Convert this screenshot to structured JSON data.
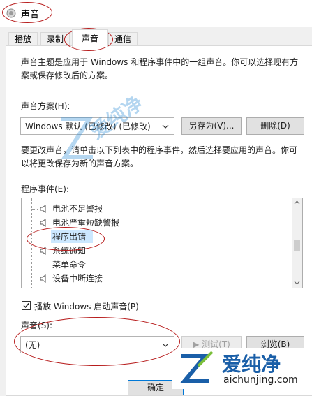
{
  "window": {
    "title": "声音"
  },
  "tabs": [
    {
      "label": "播放"
    },
    {
      "label": "录制"
    },
    {
      "label": "声音"
    },
    {
      "label": "通信"
    }
  ],
  "description": {
    "line1": "声音主题是应用于 Windows 和程序事件中的一组声音。你可以选择现有方",
    "line2": "案或保存修改后的方案。"
  },
  "scheme": {
    "label": "声音方案(H):",
    "value": "Windows 默认 (已修改) (已修改)",
    "save_as_button": "另存为(V)...",
    "delete_button": "删除(D)"
  },
  "instructions": {
    "line1": "要更改声音，请单击以下列表中的程序事件，然后选择要应用的声音。你可",
    "line2": "以将更改保存为新的声音方案。"
  },
  "events": {
    "label": "程序事件(E):",
    "items": [
      {
        "label": "电池不足警报",
        "has_sound": true,
        "selected": false
      },
      {
        "label": "电池严重短缺警报",
        "has_sound": true,
        "selected": false
      },
      {
        "label": "程序出错",
        "has_sound": false,
        "selected": true
      },
      {
        "label": "系统通知",
        "has_sound": true,
        "selected": false
      },
      {
        "label": "菜单命令",
        "has_sound": false,
        "selected": false
      },
      {
        "label": "设备中断连接",
        "has_sound": true,
        "selected": false
      }
    ]
  },
  "startup": {
    "label": "播放 Windows 启动声音(P)",
    "checked": true
  },
  "sound": {
    "label": "声音(S):",
    "value": "(无)",
    "test_button": "测试(T)",
    "browse_button": "浏览(B)"
  },
  "footer": {
    "ok_button": "确定"
  },
  "watermark": {
    "brand": "爱纯净",
    "url": "aichunjing.com"
  },
  "colors": {
    "selection": "#cce8ff",
    "annotation": "#b71c1c",
    "accent": "#0a64ad"
  }
}
